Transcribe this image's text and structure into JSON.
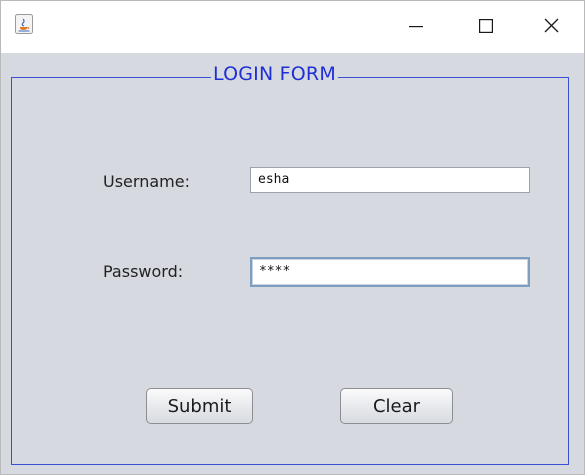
{
  "window": {
    "app_icon": "java-cup-icon",
    "controls": {
      "minimize_icon": "minimize-icon",
      "maximize_icon": "maximize-icon",
      "close_icon": "close-icon"
    }
  },
  "form": {
    "legend": "LOGIN FORM",
    "username_label": "Username:",
    "username_value": "esha",
    "password_label": "Password:",
    "password_value": "****",
    "submit_label": "Submit",
    "clear_label": "Clear"
  },
  "colors": {
    "panel_background": "#d6d9df",
    "legend_text": "#1f2fd6",
    "border": "#3b4fd6"
  }
}
